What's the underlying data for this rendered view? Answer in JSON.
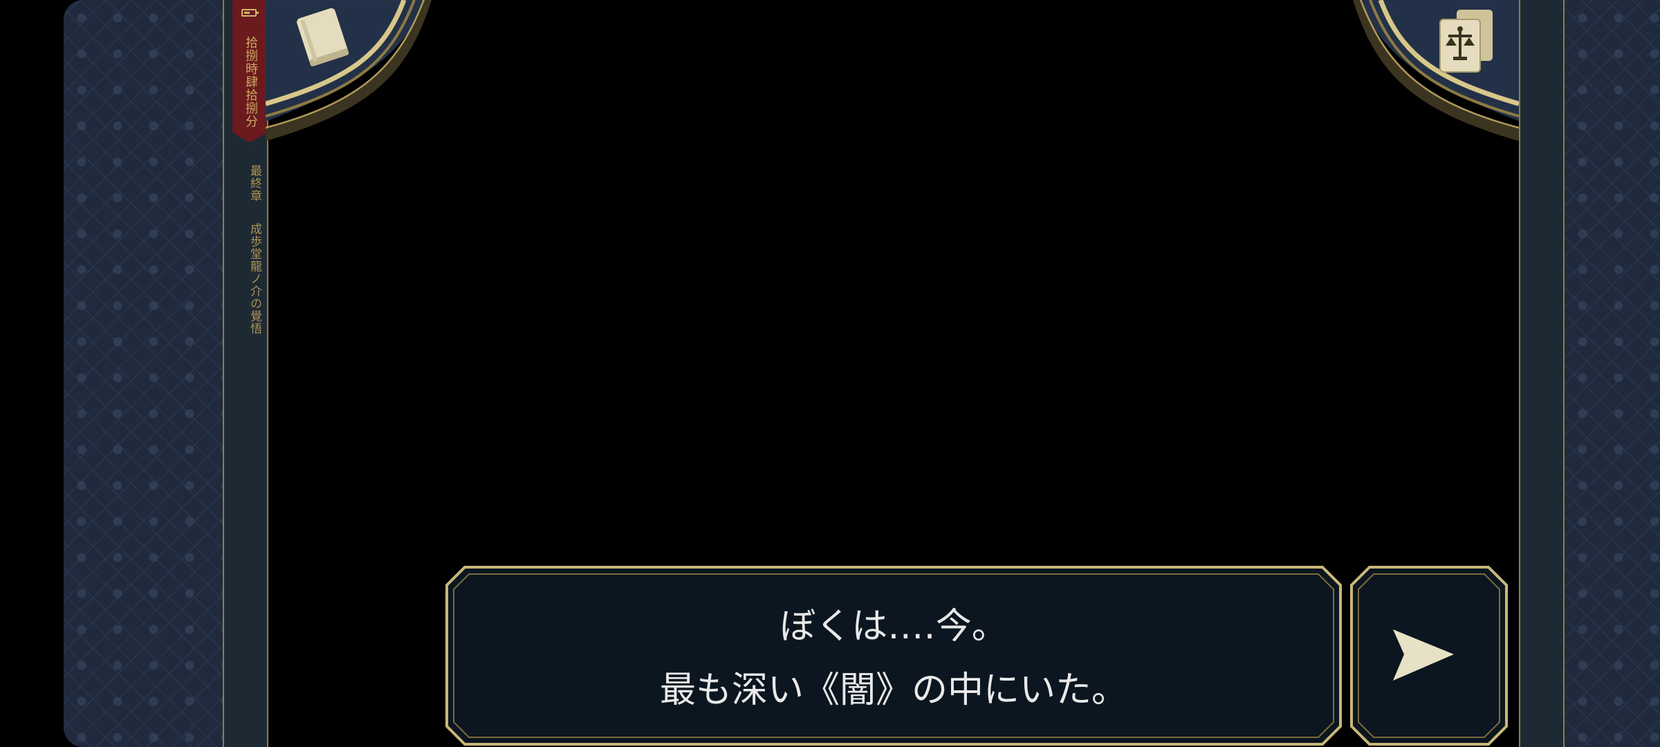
{
  "status": {
    "clock_text": "拾捌時肆拾捌分",
    "battery_icon": "battery-icon"
  },
  "chapter": {
    "label": "最終章",
    "title": "成歩堂龍ノ介の覺悟"
  },
  "buttons": {
    "court_record_icon": "book-icon",
    "evidence_icon": "scales-card-icon",
    "next_icon": "play-arrow-icon"
  },
  "dialogue": {
    "line1": "ぼくは‥‥今。",
    "line2": "最も深い《闇》の中にいた。"
  },
  "colors": {
    "gold": "#c9b77a",
    "ribbon": "#6b1a1d",
    "dialogue_bg": "#0c1620",
    "panel": "#1f2a3d"
  }
}
